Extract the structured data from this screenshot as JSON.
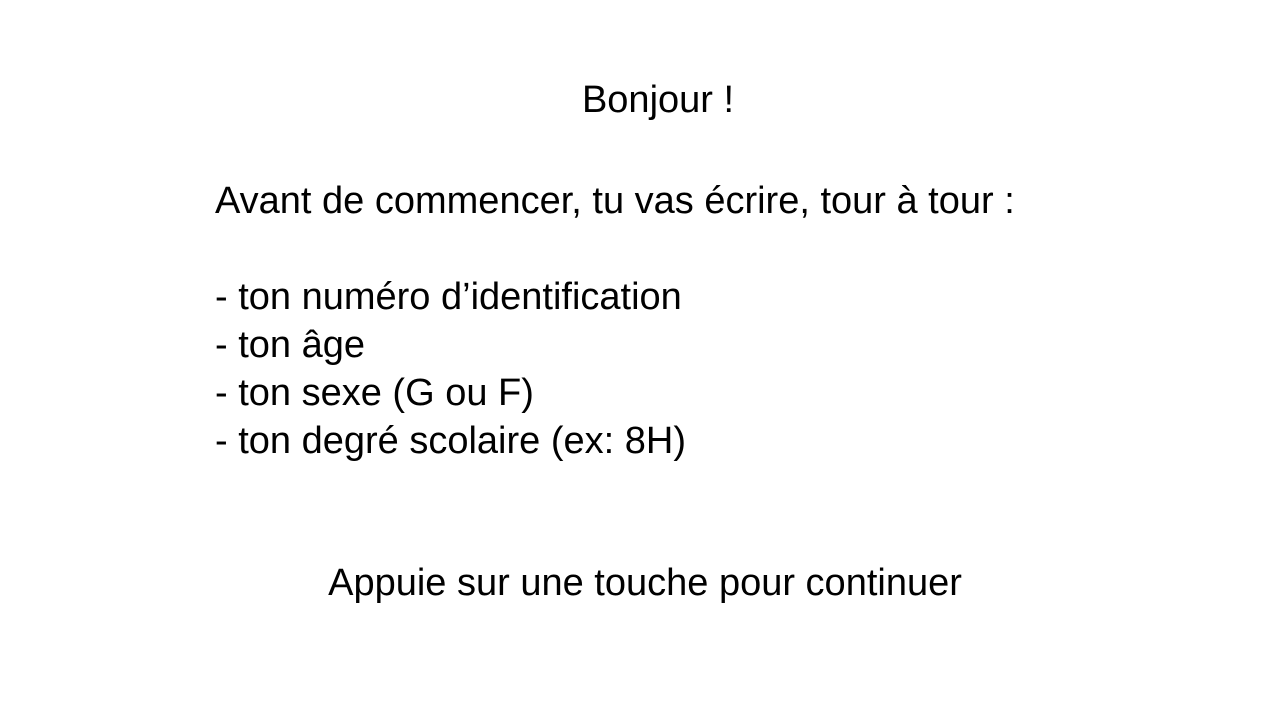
{
  "screen": {
    "greeting": "Bonjour !",
    "intro": "Avant de commencer, tu vas écrire, tour à tour :",
    "fields": [
      "- ton numéro d’identification",
      "- ton âge",
      "- ton sexe (G ou F)",
      "- ton degré scolaire (ex: 8H)"
    ],
    "continue_prompt": "Appuie sur une touche pour continuer"
  },
  "colors": {
    "background": "#ffffff",
    "text": "#000000"
  }
}
